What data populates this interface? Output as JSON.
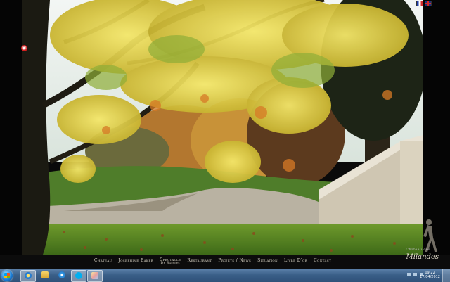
{
  "nav": {
    "items": [
      {
        "label": "Château"
      },
      {
        "label": "Joséphine Baker"
      },
      {
        "label": "Spectacle",
        "sub": "de rapaces"
      },
      {
        "label": "Restaurant"
      },
      {
        "label": "Projets / News"
      },
      {
        "label": "Situation"
      },
      {
        "label": "Livre d'or"
      },
      {
        "label": "Contact"
      }
    ]
  },
  "brand": {
    "chateau": "Château des",
    "name": "Milandes"
  },
  "music": {
    "icon": "music-toggle-icon",
    "glyph": "◉"
  },
  "flags": [
    "fr-flag-icon",
    "uk-flag-icon"
  ],
  "taskbar": {
    "clock_time": "09:22",
    "clock_date": "17/04/2012",
    "apps": [
      "ie-icon",
      "explorer-icon",
      "media-player-icon",
      "skype-icon",
      "paint-icon"
    ]
  }
}
